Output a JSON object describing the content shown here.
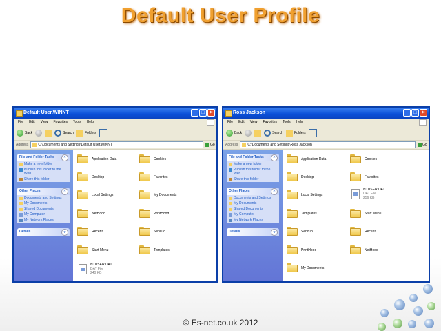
{
  "slide_title": "Default User Profile",
  "footer": "© Es-net.co.uk 2012",
  "colors": {
    "title": "#f0a030",
    "xp_title": "#0a4fd8",
    "taskpane": "#7ba2e7",
    "link": "#215dc6"
  },
  "windows": [
    {
      "title": "Default User.WINNT",
      "menu": [
        "File",
        "Edit",
        "View",
        "Favorites",
        "Tools",
        "Help"
      ],
      "toolbar": {
        "back": "Back",
        "search": "Search",
        "folders": "Folders"
      },
      "address_label": "Address",
      "address": "C:\\Documents and Settings\\Default User.WINNT",
      "go": "Go",
      "file_tasks": {
        "title": "File and Folder Tasks",
        "links": [
          "Make a new folder",
          "Publish this folder to the Web",
          "Share this folder"
        ]
      },
      "other_places": {
        "title": "Other Places",
        "links": [
          "Documents and Settings",
          "My Documents",
          "Shared Documents",
          "My Computer",
          "My Network Places"
        ]
      },
      "details": "Details",
      "items": [
        {
          "name": "Application Data",
          "type": "folder"
        },
        {
          "name": "Cookies",
          "type": "folder"
        },
        {
          "name": "Desktop",
          "type": "folder"
        },
        {
          "name": "Favorites",
          "type": "folder"
        },
        {
          "name": "Local Settings",
          "type": "folder"
        },
        {
          "name": "My Documents",
          "type": "folder"
        },
        {
          "name": "NetHood",
          "type": "folder"
        },
        {
          "name": "PrintHood",
          "type": "folder"
        },
        {
          "name": "Recent",
          "type": "folder"
        },
        {
          "name": "SendTo",
          "type": "folder"
        },
        {
          "name": "Start Menu",
          "type": "folder"
        },
        {
          "name": "Templates",
          "type": "folder"
        },
        {
          "name": "NTUSER.DAT",
          "type": "file",
          "kind": "DAT File",
          "size": "240 KB"
        }
      ]
    },
    {
      "title": "Ross Jackson",
      "menu": [
        "File",
        "Edit",
        "View",
        "Favorites",
        "Tools",
        "Help"
      ],
      "toolbar": {
        "back": "Back",
        "search": "Search",
        "folders": "Folders"
      },
      "address_label": "Address",
      "address": "C:\\Documents and Settings\\Ross Jackson",
      "go": "Go",
      "file_tasks": {
        "title": "File and Folder Tasks",
        "links": [
          "Make a new folder",
          "Publish this folder to the Web",
          "Share this folder"
        ]
      },
      "other_places": {
        "title": "Other Places",
        "links": [
          "Documents and Settings",
          "My Documents",
          "Shared Documents",
          "My Computer",
          "My Network Places"
        ]
      },
      "details": "Details",
      "items": [
        {
          "name": "Application Data",
          "type": "folder"
        },
        {
          "name": "Cookies",
          "type": "folder"
        },
        {
          "name": "Desktop",
          "type": "folder"
        },
        {
          "name": "Favorites",
          "type": "folder"
        },
        {
          "name": "Local Settings",
          "type": "folder"
        },
        {
          "name": "NTUSER.DAT",
          "type": "file",
          "kind": "DAT File",
          "size": "256 KB"
        },
        {
          "name": "Templates",
          "type": "folder"
        },
        {
          "name": "Start Menu",
          "type": "folder"
        },
        {
          "name": "SendTo",
          "type": "folder"
        },
        {
          "name": "Recent",
          "type": "folder"
        },
        {
          "name": "PrintHood",
          "type": "folder"
        },
        {
          "name": "NetHood",
          "type": "folder"
        },
        {
          "name": "My Documents",
          "type": "folder"
        }
      ]
    }
  ]
}
